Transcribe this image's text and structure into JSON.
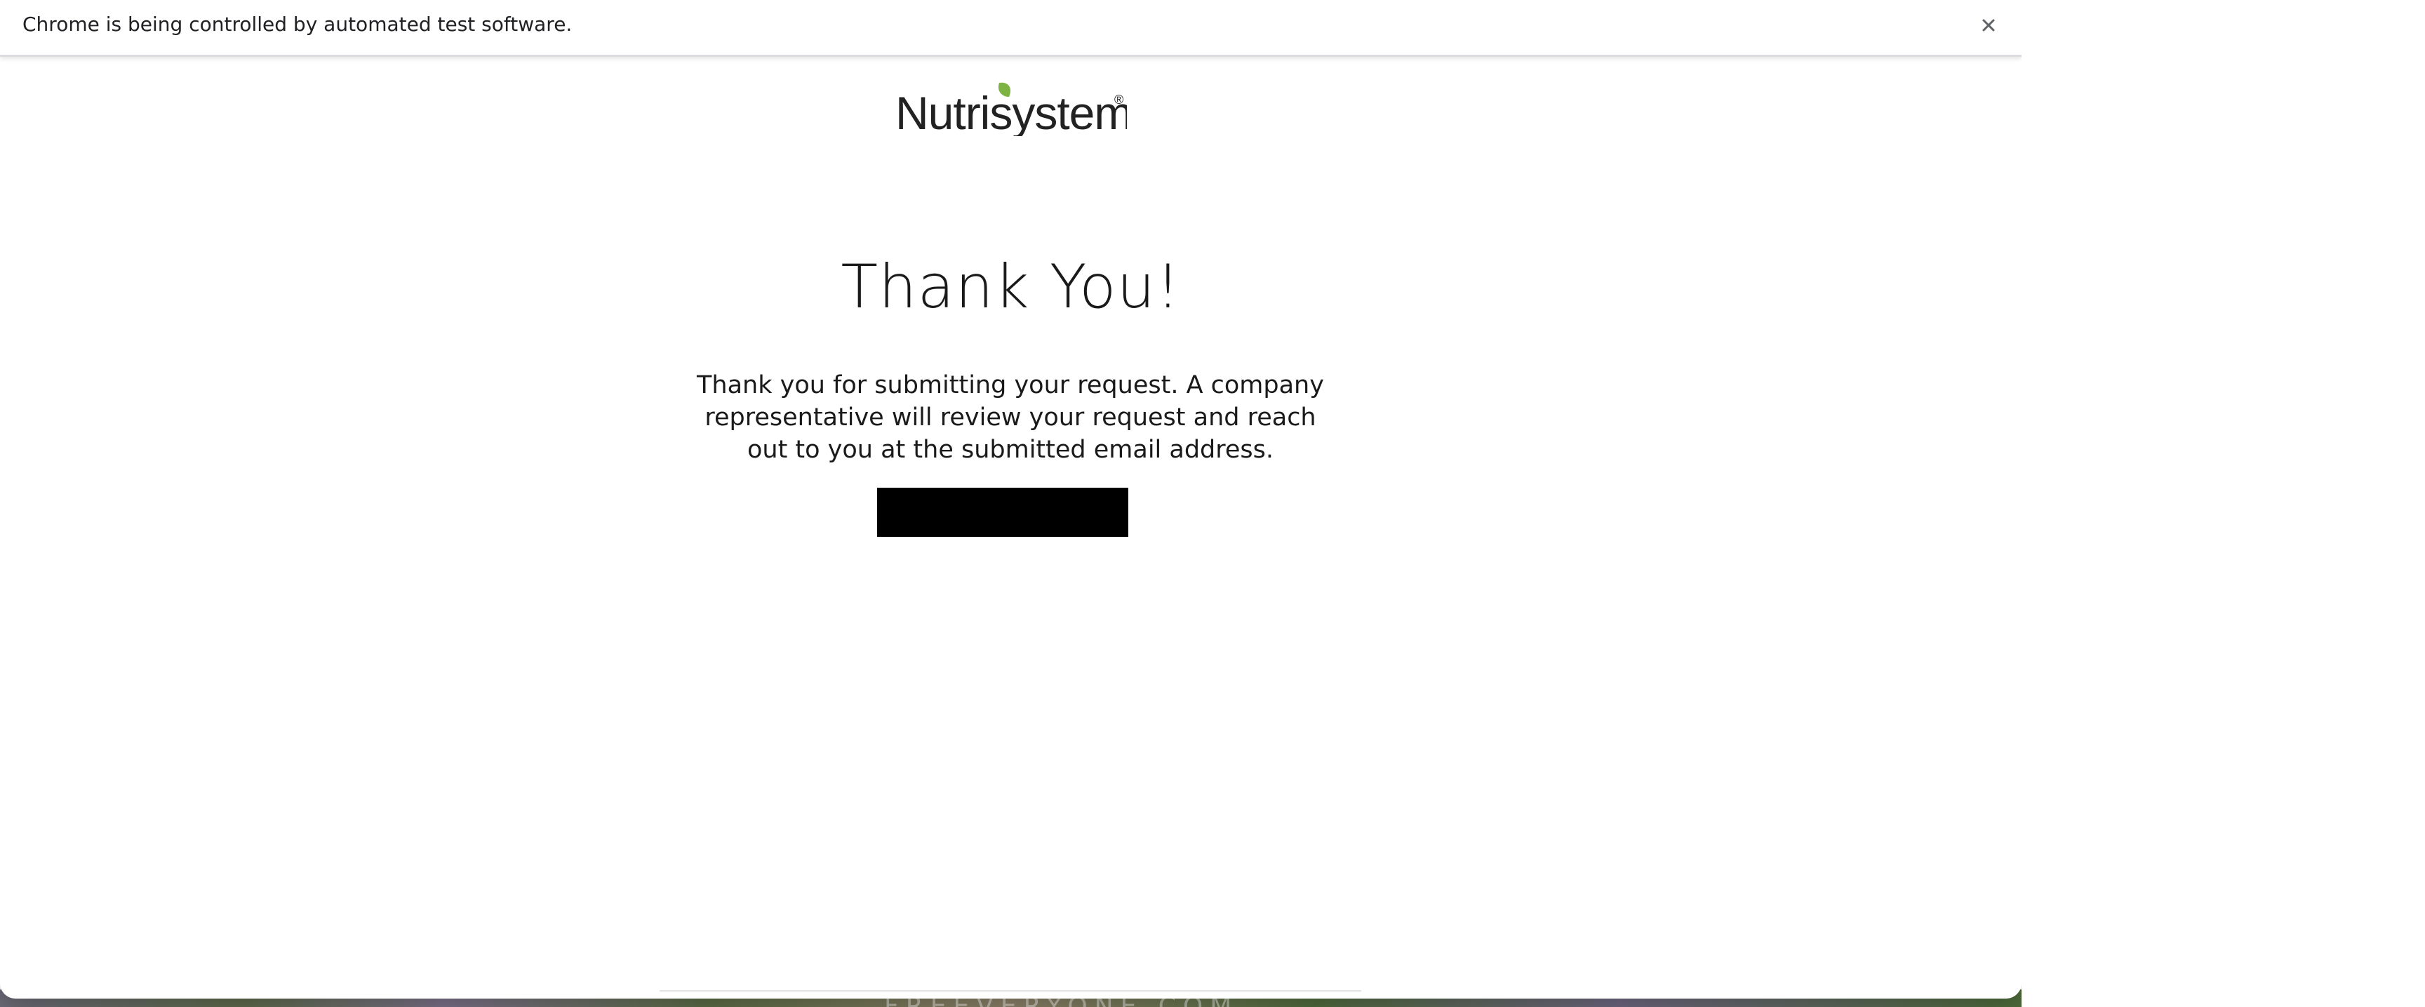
{
  "infobar": {
    "message": "Chrome is being controlled by automated test software.",
    "close_icon": "close-icon"
  },
  "brand": {
    "logo_text": "Nutrisystem",
    "registered_mark": "®",
    "leaf_color": "#7cb342",
    "text_color": "#222222"
  },
  "confirmation": {
    "heading": "Thank You!",
    "message": "Thank you for submitting your request. A company representative will review your request and reach out to you at the submitted email address.",
    "button_label": ""
  },
  "background": {
    "watermark": "FREEVERYONE.COM"
  },
  "colors": {
    "button": "#000000",
    "text": "#1a1a1a",
    "infobar_border": "#dadce0"
  }
}
